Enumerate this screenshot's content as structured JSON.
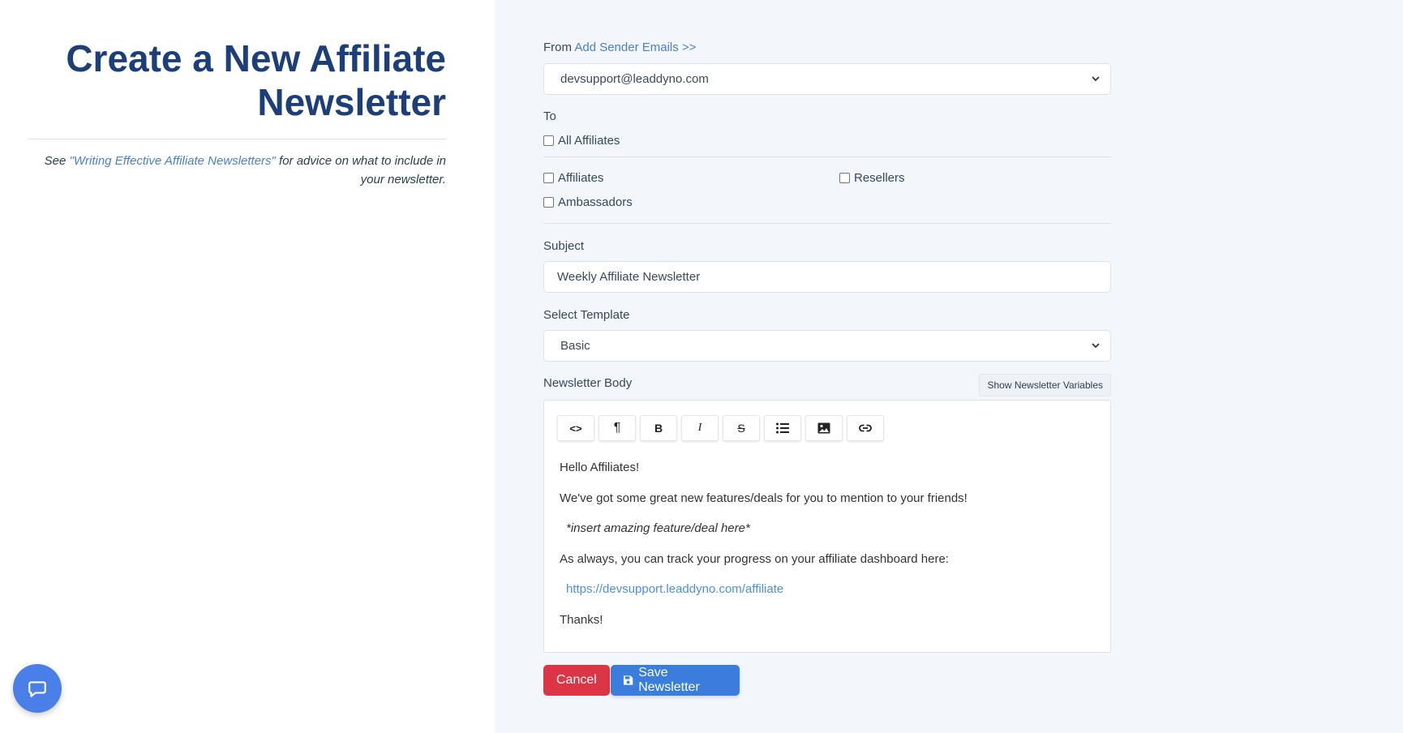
{
  "page": {
    "title": "Create a New Affiliate Newsletter",
    "advice_prefix": "See ",
    "advice_link": "\"Writing Effective Affiliate Newsletters\"",
    "advice_suffix": " for advice on what to include in your newsletter."
  },
  "form": {
    "from_label": "From",
    "add_sender_link": "Add Sender Emails >>",
    "from_value": "devsupport@leaddyno.com",
    "to_label": "To",
    "recipients": {
      "all_affiliates": "All Affiliates",
      "affiliates": "Affiliates",
      "resellers": "Resellers",
      "ambassadors": "Ambassadors"
    },
    "subject_label": "Subject",
    "subject_value": "Weekly Affiliate Newsletter",
    "template_label": "Select Template",
    "template_value": "Basic",
    "body_label": "Newsletter Body",
    "show_variables_label": "Show Newsletter Variables"
  },
  "toolbar": {
    "code_label": "<>",
    "paragraph_label": "¶",
    "bold_label": "B",
    "italic_label": "I",
    "strike_label": "S"
  },
  "editor": {
    "greeting": "Hello Affiliates!",
    "intro": "We've got some great new features/deals for you to mention to your friends!",
    "placeholder": "*insert amazing feature/deal here*",
    "tracking": "As always, you can track your progress on your affiliate dashboard here:",
    "dashboard_link": "https://devsupport.leaddyno.com/affiliate",
    "signoff": "Thanks!"
  },
  "actions": {
    "cancel_label": "Cancel",
    "save_label": "Save Newsletter"
  },
  "colors": {
    "title": "#1c3f7a",
    "link": "#4a7fd0",
    "cancel": "#dc3545",
    "save": "#3b7ddd",
    "right_pane_bg": "#f3f7fc"
  }
}
